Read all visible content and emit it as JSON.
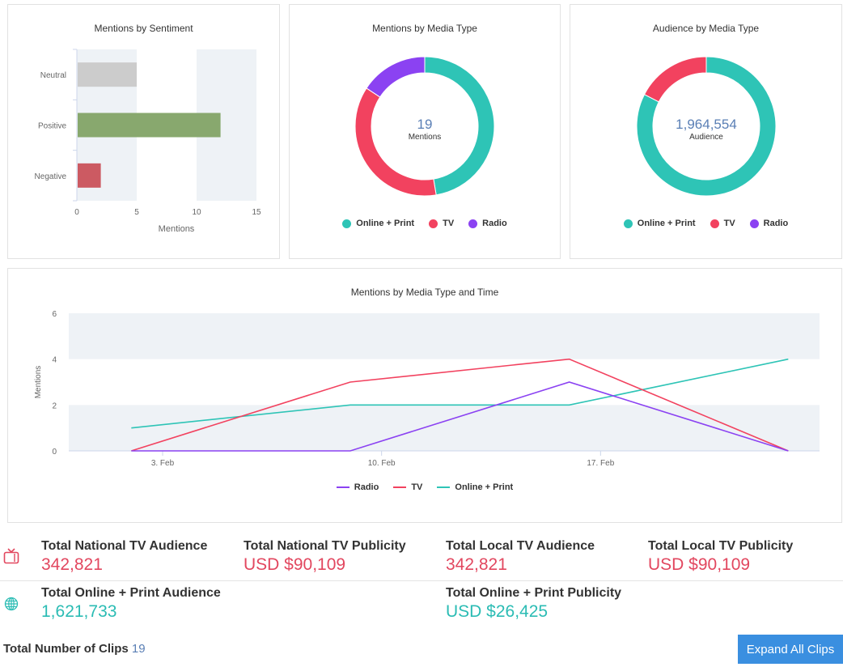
{
  "chart_data": [
    {
      "type": "bar",
      "orientation": "horizontal",
      "title": "Mentions by Sentiment",
      "categories": [
        "Neutral",
        "Positive",
        "Negative"
      ],
      "values": [
        5,
        12,
        2
      ],
      "colors": [
        "#cccccc",
        "#88a86e",
        "#cc5a62"
      ],
      "xlabel": "Mentions",
      "xlim": [
        0,
        15
      ],
      "xticks": [
        "0",
        "5",
        "10",
        "15"
      ],
      "grid": "alternating bands"
    },
    {
      "type": "pie",
      "donut": true,
      "title": "Mentions by Media Type",
      "center_value": "19",
      "center_label": "Mentions",
      "categories": [
        "Online + Print",
        "TV",
        "Radio"
      ],
      "values": [
        9,
        7,
        3
      ],
      "colors": [
        "#2ec4b6",
        "#f2425f",
        "#8b42f2"
      ],
      "legend": "bottom"
    },
    {
      "type": "pie",
      "donut": true,
      "title": "Audience by Media Type",
      "center_value": "1,964,554",
      "center_label": "Audience",
      "categories": [
        "Online + Print",
        "TV",
        "Radio"
      ],
      "values": [
        1621733,
        342821,
        0
      ],
      "colors": [
        "#2ec4b6",
        "#f2425f",
        "#8b42f2"
      ],
      "legend": "bottom"
    },
    {
      "type": "line",
      "title": "Mentions by Media Type and Time",
      "ylabel": "Mentions",
      "ylim": [
        0,
        6
      ],
      "yticks": [
        "0",
        "2",
        "4",
        "6"
      ],
      "x": [
        "2020-02-02",
        "2020-02-09",
        "2020-02-16",
        "2020-02-23"
      ],
      "xticks": [
        {
          "date": "2020-02-03",
          "label": "3. Feb"
        },
        {
          "date": "2020-02-10",
          "label": "10. Feb"
        },
        {
          "date": "2020-02-17",
          "label": "17. Feb"
        }
      ],
      "series": [
        {
          "name": "Radio",
          "color": "#8b42f2",
          "values": [
            0,
            0,
            3,
            0
          ]
        },
        {
          "name": "TV",
          "color": "#f2425f",
          "values": [
            0,
            3,
            4,
            0
          ]
        },
        {
          "name": "Online + Print",
          "color": "#2ec4b6",
          "values": [
            1,
            2,
            2,
            4
          ]
        }
      ],
      "legend": "bottom"
    }
  ],
  "stats": {
    "national_tv_audience": {
      "label": "Total National TV Audience",
      "value": "342,821"
    },
    "national_tv_publicity": {
      "label": "Total National TV Publicity",
      "value": "USD $90,109"
    },
    "local_tv_audience": {
      "label": "Total Local TV Audience",
      "value": "342,821"
    },
    "local_tv_publicity": {
      "label": "Total Local TV Publicity",
      "value": "USD $90,109"
    },
    "online_audience": {
      "label": "Total Online + Print Audience",
      "value": "1,621,733"
    },
    "online_publicity": {
      "label": "Total Online + Print Publicity",
      "value": "USD $26,425"
    }
  },
  "icons": {
    "tv": "tv-icon",
    "globe": "globe-icon"
  },
  "clips": {
    "label": "Total Number of Clips",
    "count": "19"
  },
  "expand_button": {
    "label": "Expand All Clips"
  }
}
